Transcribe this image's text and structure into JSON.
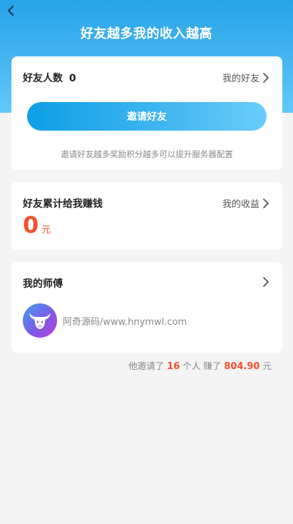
{
  "header": {
    "title": "好友越多我的收入越高",
    "back_icon": "chevron-left-icon"
  },
  "friends_card": {
    "label": "好友人数",
    "count": "0",
    "link_label": "我的好友",
    "invite_button": "邀请好友",
    "hint": "邀请好友越多奖励积分越多可以提升服务器配置"
  },
  "earnings_card": {
    "label": "好友累计给我赚钱",
    "link_label": "我的收益",
    "amount": "0",
    "unit": "元"
  },
  "master_card": {
    "label": "我的师傅",
    "name": "阿奇源码/www.hnymwl.com",
    "avatar_icon": "bull-logo-icon"
  },
  "summary": {
    "prefix": "他邀请了",
    "invited_count": "16",
    "mid": "个人 赚了",
    "earned": "804.90",
    "suffix": "元"
  },
  "colors": {
    "accent_blue": "#27a3e8",
    "highlight_red": "#f4502a",
    "background": "#f4f4f4"
  }
}
